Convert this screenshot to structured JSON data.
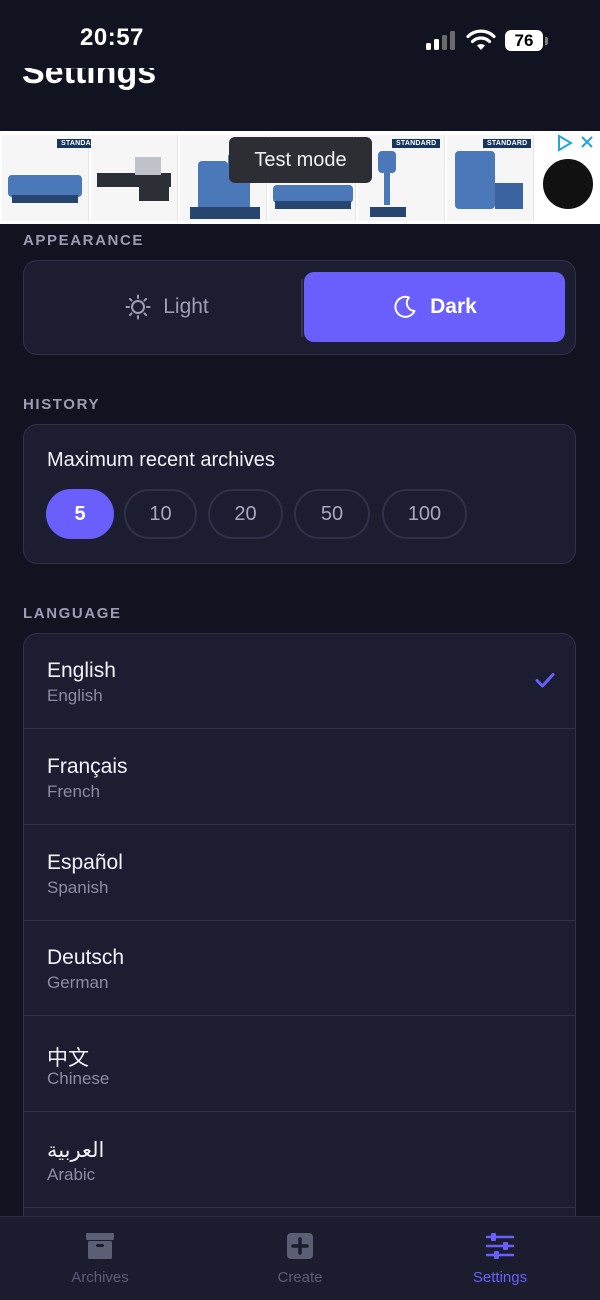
{
  "status_bar": {
    "time": "20:57",
    "battery": "76"
  },
  "header": {
    "title": "Settings"
  },
  "ad": {
    "tooltip": "Test mode",
    "brand_badge": "STANDARD"
  },
  "appearance": {
    "section_label": "APPEARANCE",
    "options": [
      {
        "label": "Light",
        "icon": "sun-icon",
        "selected": false
      },
      {
        "label": "Dark",
        "icon": "moon-icon",
        "selected": true
      }
    ]
  },
  "history": {
    "section_label": "HISTORY",
    "title": "Maximum recent archives",
    "options": [
      "5",
      "10",
      "20",
      "50",
      "100"
    ],
    "selected": "5"
  },
  "language": {
    "section_label": "LANGUAGE",
    "items": [
      {
        "native": "English",
        "english": "English",
        "selected": true
      },
      {
        "native": "Français",
        "english": "French",
        "selected": false
      },
      {
        "native": "Español",
        "english": "Spanish",
        "selected": false
      },
      {
        "native": "Deutsch",
        "english": "German",
        "selected": false
      },
      {
        "native": "中文",
        "english": "Chinese",
        "selected": false
      },
      {
        "native": "العربية",
        "english": "Arabic",
        "selected": false
      }
    ]
  },
  "tab_bar": {
    "tabs": [
      {
        "label": "Archives",
        "icon": "archive-box-icon",
        "active": false
      },
      {
        "label": "Create",
        "icon": "plus-square-icon",
        "active": false
      },
      {
        "label": "Settings",
        "icon": "sliders-icon",
        "active": true
      }
    ]
  },
  "colors": {
    "accent": "#6a5ffc",
    "background": "#121320",
    "card": "#1c1d31",
    "muted": "#8a8ca4"
  }
}
